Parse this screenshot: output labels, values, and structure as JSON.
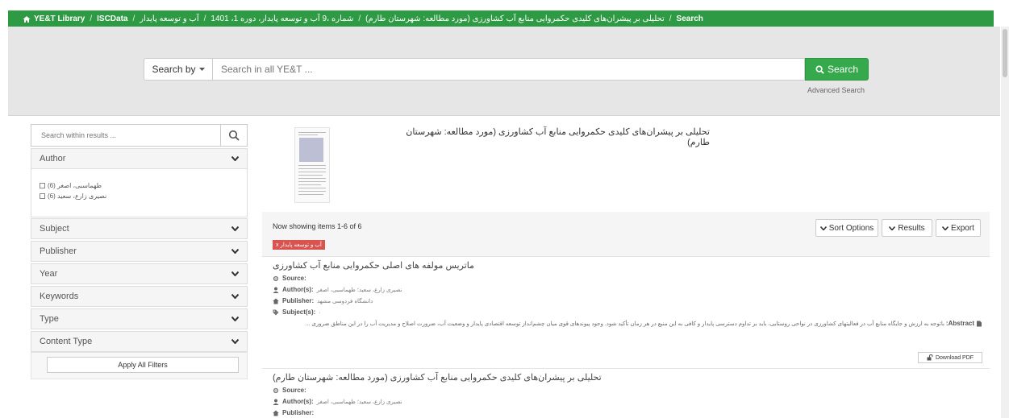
{
  "colors": {
    "brand_green": "#2e9a44",
    "search_green": "#35a94c",
    "tag_red": "#d9534f",
    "hero_gray": "#e6e6e6"
  },
  "breadcrumb": {
    "home_icon": "home-icon",
    "items": [
      "YE&T Library",
      "ISCData",
      "آب و توسعه پایدار",
      "1401 ،1 شماره ،9 آب و توسعه پایدار، دوره",
      "تحلیلی بر پیشران‌های کلیدی حکمروایی منابع آب کشاورزی (مورد مطالعه: شهرستان طارم)",
      "Search"
    ]
  },
  "search": {
    "search_by_label": "Search by",
    "placeholder": "Search in all YE&T ...",
    "button_label": "Search",
    "advanced_label": "Advanced Search"
  },
  "sidebar": {
    "within_placeholder": "Search within results ...",
    "facets": {
      "author": "Author",
      "subject": "Subject",
      "publisher": "Publisher",
      "year": "Year",
      "keywords": "Keywords",
      "type": "Type",
      "content_type": "Content Type"
    },
    "author_options": [
      {
        "label": "طهماسبی، اصغر (6)"
      },
      {
        "label": "نصیری زارع، سعید (6)"
      }
    ],
    "apply_label": "Apply All Filters"
  },
  "featured": {
    "title": "تحلیلی بر پیشران‌های کلیدی حکمروایی منابع آب کشاورزی (مورد مطالعه: شهرستان طارم)"
  },
  "results": {
    "showing": "Now showing items 1-6 of 6",
    "active_filter": "آب و توسعه پایدار",
    "sort_label": "Sort Options",
    "results_label": "Results",
    "export_label": "Export",
    "items": [
      {
        "title": "ماتریس مولفه های اصلی حکمروایی منابع آب کشاورزی",
        "source_label": "Source:",
        "authors_label": "Author(s):",
        "authors_value": "نصیری زارع، سعید؛ طهماسبی، اصغر",
        "publisher_label": "Publisher:",
        "publisher_value": "دانشگاه فردوسی مشهد",
        "subjects_label": "Subject(s):",
        "subjects_value": ".",
        "abstract_label": "Abstract:",
        "abstract_text": "باتوجه به ارزش و جایگاه منابع آب در فعالیتهای کشاورزی در نواحی روستایی، باید بر تداوم دسترسی پایدار و کافی به این منبع در هر زمان تأکید شود. وجود پیوندهای قوی میان چشم‌انداز توسعه اقتصادی پایدار و وضعیت آب، ضرورت اصلاح و مدیریت آب را در این مناطق ضروری ...",
        "download_label": "Download PDF"
      },
      {
        "title": "تحلیلی بر پیشران‌های کلیدی حکمروایی منابع آب کشاورزی (مورد مطالعه: شهرستان طارم)",
        "source_label": "Source:",
        "authors_label": "Author(s):",
        "authors_value": "نصیری زارع، سعید؛ طهماسبی، اصغر",
        "publisher_label": "Publisher:"
      }
    ]
  }
}
